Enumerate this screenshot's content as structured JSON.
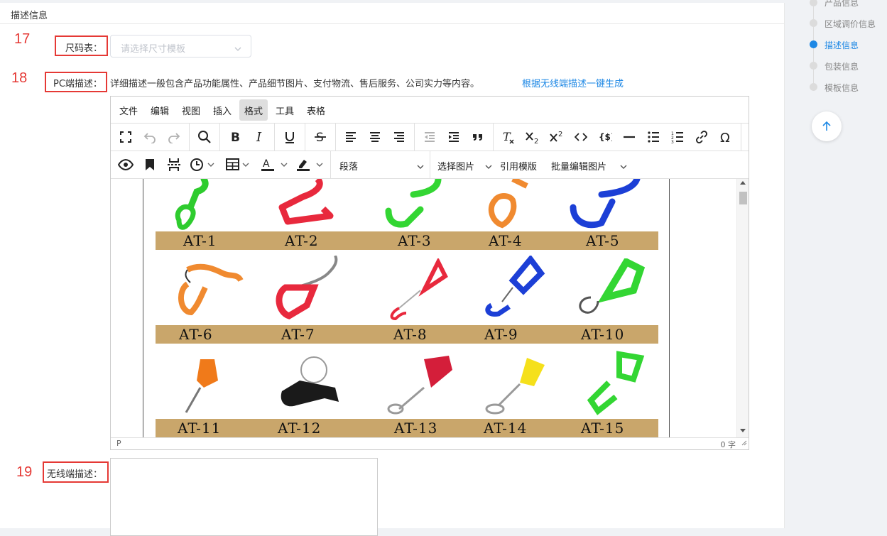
{
  "section": {
    "title": "描述信息"
  },
  "steps": {
    "s17": "17",
    "s18": "18",
    "s19": "19"
  },
  "size_chart": {
    "label": "尺码表：",
    "placeholder": "请选择尺寸模板"
  },
  "pc_desc": {
    "label": "PC端描述：",
    "hint": "详细描述一般包含产品功能属性、产品细节图片、支付物流、售后服务、公司实力等内容。",
    "generate_link": "根据无线端描述一键生成"
  },
  "editor": {
    "menus": [
      "文件",
      "编辑",
      "视图",
      "插入",
      "格式",
      "工具",
      "表格"
    ],
    "active_menu": "格式",
    "paragraph_format": "段落",
    "select_image": "选择图片",
    "reference_template": "引用模版",
    "batch_edit_image": "批量编辑图片",
    "status_path": "P",
    "word_count": "0 字",
    "content_rows": [
      [
        "AT-1",
        "AT-2",
        "AT-3",
        "AT-4",
        "AT-5"
      ],
      [
        "AT-6",
        "AT-7",
        "AT-8",
        "AT-9",
        "AT-10"
      ],
      [
        "AT-11",
        "AT-12",
        "AT-13",
        "AT-14",
        "AT-15"
      ]
    ]
  },
  "wireless_desc": {
    "label": "无线端描述："
  },
  "side_nav": {
    "items": [
      "产品信息",
      "区域调价信息",
      "描述信息",
      "包装信息",
      "模板信息"
    ],
    "active": "描述信息"
  },
  "colors": {
    "accent": "#1e88e5",
    "step_red": "#e53935",
    "band": "#c9a66b"
  }
}
